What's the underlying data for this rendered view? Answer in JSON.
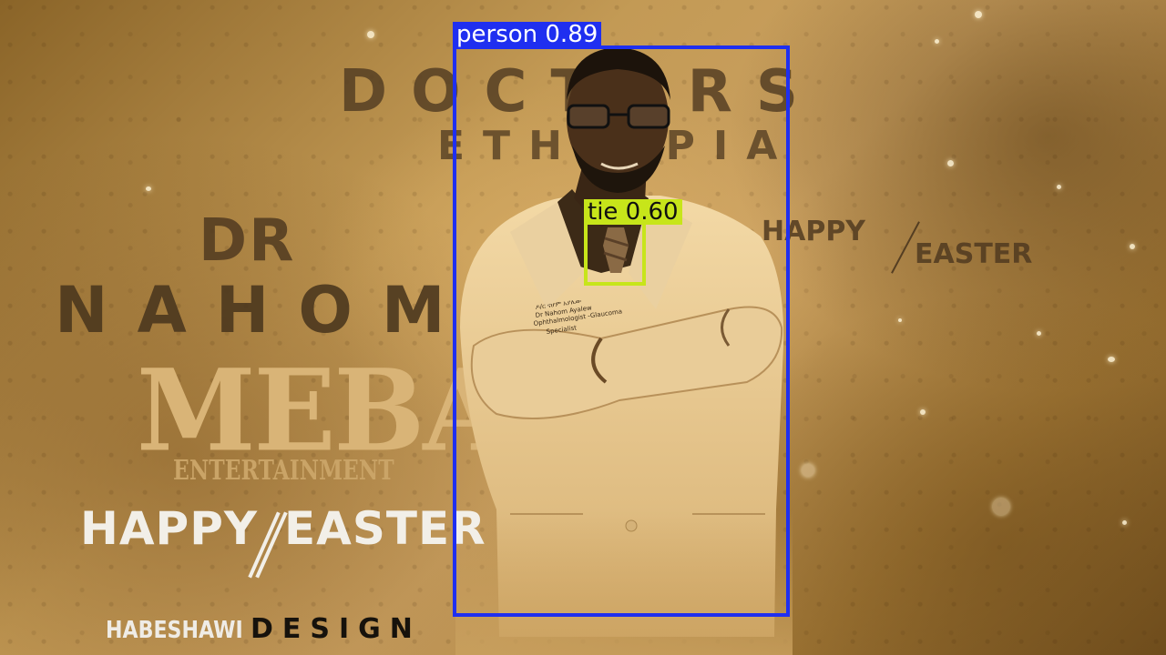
{
  "poster": {
    "title_line1": "DOCTORS",
    "title_line2": "ETHIOPIA",
    "name_line1": "DR",
    "name_line2": "NAHOM",
    "brand_main": "MEBA",
    "brand_sub": "ENTERTAINMENT",
    "greeting_left_a": "HAPPY",
    "greeting_left_b": "EASTER",
    "greeting_right_a": "HAPPY",
    "greeting_right_b": "EASTER",
    "credit_a": "HABESHAWI",
    "credit_b": "DESIGN",
    "badge_line1": "ዶ/ር ናሆም አያሌው",
    "badge_line2": "Dr Nahom Ayalew",
    "badge_line3": "Ophthalmologist -Glaucoma",
    "badge_line4": "Specialist"
  },
  "detections": [
    {
      "label": "person 0.89",
      "class": "person",
      "confidence": 0.89,
      "color": "#1f2ff0"
    },
    {
      "label": "tie 0.60",
      "class": "tie",
      "confidence": 0.6,
      "color": "#c7e51a"
    }
  ],
  "colors": {
    "background": "#c39a55",
    "poster_text_dark": "#553e23",
    "brand": "#d9b477",
    "greeting_white": "#f2efe8"
  }
}
